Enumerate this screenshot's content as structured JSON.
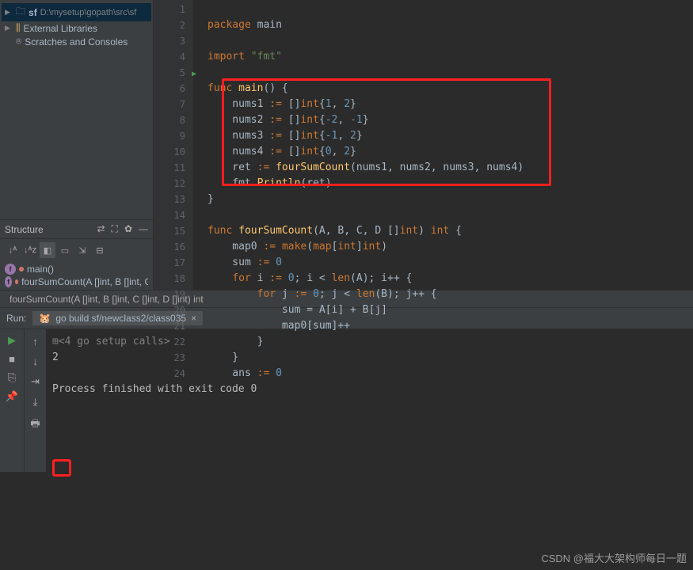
{
  "project": {
    "root_name": "sf",
    "root_path": "D:\\mysetup\\gopath\\src\\sf",
    "external_libs": "External Libraries",
    "scratches": "Scratches and Consoles"
  },
  "structure": {
    "title": "Structure",
    "items": [
      {
        "name": "main()"
      },
      {
        "name": "fourSumCount(A []int, B []int, C []int, D []int) int",
        "locked": true
      }
    ]
  },
  "editor": {
    "lines": [
      "1",
      "2",
      "3",
      "4",
      "5",
      "6",
      "7",
      "8",
      "9",
      "10",
      "11",
      "12",
      "13",
      "14",
      "15",
      "16",
      "17",
      "18",
      "19",
      "20",
      "21",
      "22",
      "23",
      "24"
    ],
    "code": {
      "l1_pkg": "package",
      "l1_main": " main",
      "l3_imp": "import",
      "l3_fmt": " \"fmt\"",
      "l5_func": "func",
      "l5_main": " main",
      "l5_rest": "() {",
      "l6_a": "    nums1 ",
      "l6_b": ":=",
      "l6_c": " []",
      "l6_int": "int",
      "l6_d": "{",
      "l6_n1": "1",
      "l6_e": ", ",
      "l6_n2": "2",
      "l6_f": "}",
      "l7_a": "    nums2 ",
      "l7_b": ":=",
      "l7_c": " []",
      "l7_int": "int",
      "l7_d": "{",
      "l7_n1": "-2",
      "l7_e": ", ",
      "l7_n2": "-1",
      "l7_f": "}",
      "l8_a": "    nums3 ",
      "l8_b": ":=",
      "l8_c": " []",
      "l8_int": "int",
      "l8_d": "{",
      "l8_n1": "-1",
      "l8_e": ", ",
      "l8_n2": "2",
      "l8_f": "}",
      "l9_a": "    nums4 ",
      "l9_b": ":=",
      "l9_c": " []",
      "l9_int": "int",
      "l9_d": "{",
      "l9_n1": "0",
      "l9_e": ", ",
      "l9_n2": "2",
      "l9_f": "}",
      "l10_a": "    ret ",
      "l10_b": ":=",
      "l10_c": " ",
      "l10_fn": "fourSumCount",
      "l10_d": "(nums1, nums2, nums3, nums4)",
      "l11_a": "    fmt.",
      "l11_fn": "Println",
      "l11_b": "(ret)",
      "l12": "}",
      "l14_func": "func",
      "l14_name": " fourSumCount",
      "l14_sig": "(A, B, C, D []",
      "l14_int": "int",
      "l14_r": ") ",
      "l14_int2": "int",
      "l14_b": " {",
      "l15_a": "    map0 ",
      "l15_b": ":=",
      "l15_c": " ",
      "l15_make": "make",
      "l15_d": "(",
      "l15_map": "map",
      "l15_e": "[",
      "l15_int1": "int",
      "l15_f": "]",
      "l15_int2": "int",
      "l15_g": ")",
      "l16_a": "    sum ",
      "l16_b": ":=",
      "l16_c": " ",
      "l16_n": "0",
      "l17_a": "    ",
      "l17_for": "for",
      "l17_b": " i ",
      "l17_c": ":=",
      "l17_d": " ",
      "l17_n": "0",
      "l17_e": "; i < ",
      "l17_len": "len",
      "l17_f": "(A); i++ {",
      "l18_a": "        ",
      "l18_for": "for",
      "l18_b": " j ",
      "l18_c": ":=",
      "l18_d": " ",
      "l18_n": "0",
      "l18_e": "; j < ",
      "l18_len": "len",
      "l18_f": "(B); j++ {",
      "l19": "            sum = A[i] + B[j]",
      "l20": "            map0[sum]++",
      "l21": "        }",
      "l22": "    }",
      "l23_a": "    ans ",
      "l23_b": ":=",
      "l23_c": " ",
      "l23_n": "0"
    }
  },
  "breadcrumb": "fourSumCount(A []int, B []int, C []int, D []int) int",
  "run": {
    "label": "Run:",
    "tab": "go build sf/newclass2/class035",
    "close": "×",
    "line1_pre": "⊞",
    "line1": "<4 go setup calls>",
    "line2": "2",
    "line4": "Process finished with exit code 0"
  },
  "watermark": "CSDN @福大大架构师每日一题"
}
